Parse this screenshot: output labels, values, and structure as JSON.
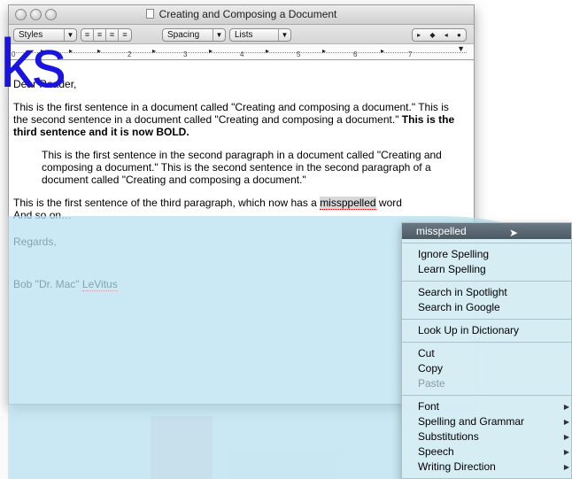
{
  "window": {
    "title": "Creating and Composing a Document"
  },
  "toolbar": {
    "styles_label": "Styles",
    "spacing_label": "Spacing",
    "lists_label": "Lists",
    "align_buttons": [
      "≡",
      "≡",
      "≡",
      "≡"
    ],
    "tab_glyphs": [
      "▸",
      "◆",
      "◂",
      "●"
    ]
  },
  "ruler": {
    "numbers": [
      "0",
      "2",
      "3",
      "4",
      "5",
      "6",
      "7"
    ]
  },
  "background": {
    "text": "ks"
  },
  "document": {
    "salutation": "Dear Reader,",
    "p1_plain": "This is the first sentence in a document called \"Creating and composing a document.\" This is the second sentence in a document called \"Creating and composing a document.\" ",
    "p1_bold": "This is the third sentence and it is now BOLD.",
    "p2": "This is the first sentence in the second paragraph in a document called \"Creating and composing a document.\" This is the second sentence in the second paragraph of a document called \"Creating and composing a document.\"",
    "p3_prefix": "This is the first sentence of the third paragraph, which now has a ",
    "p3_misspelled": "missppelled",
    "p3_suffix": " word",
    "p3_line2": "And so on…",
    "closing": "Regards,",
    "signature_first": "Bob \"Dr. Mac\" ",
    "signature_last": "LeVitus"
  },
  "context_menu": {
    "suggestion": "misspelled",
    "group1": [
      "Ignore Spelling",
      "Learn Spelling"
    ],
    "group2": [
      "Search in Spotlight",
      "Search in Google"
    ],
    "group3": [
      "Look Up in Dictionary"
    ],
    "group4": [
      "Cut",
      "Copy",
      "Paste"
    ],
    "group5": [
      "Font",
      "Spelling and Grammar",
      "Substitutions",
      "Speech",
      "Writing Direction"
    ]
  }
}
